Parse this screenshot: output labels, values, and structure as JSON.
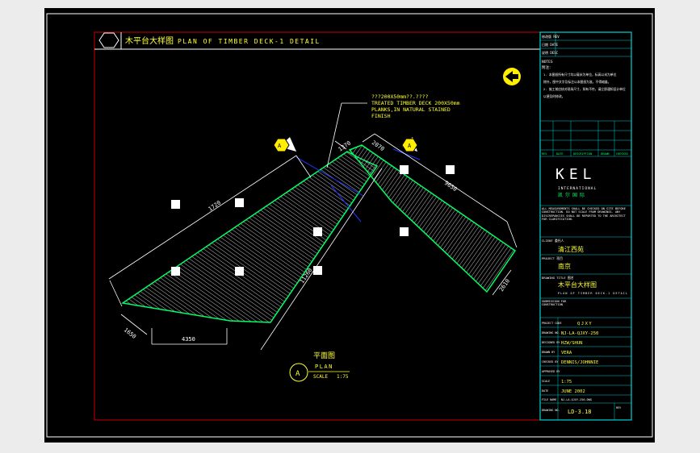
{
  "drawing": {
    "title_cn": "木平台大样图",
    "title_en": "PLAN OF TIMBER DECK-1 DETAIL",
    "note_line1": "???200X50mm??.????",
    "note_line2": "TREATED TIMBER DECK 200X50mm",
    "note_line3": "PLANKS,IN NATURAL STAINED",
    "note_line4": "FINISH",
    "dimensions": {
      "top_left": "1720",
      "top_short": "1370",
      "top_right_short": "2070",
      "right_long": "9650",
      "right_end": "2610",
      "center_long": "11260",
      "left_end": "1650",
      "bottom": "4350"
    },
    "section_marks": [
      "A",
      "A"
    ],
    "plan_label_cn": "平面图",
    "plan_label_en": "PLAN",
    "scale_label": "SCALE",
    "scale_value": "1:75",
    "plan_bubble": "A"
  },
  "title_block": {
    "rev_label": "修改版 REV",
    "date_label": "日期 DATE",
    "desc_label": "说明 DESC",
    "notes_label": "NOTES",
    "notes_sub": "附注：",
    "note_a": "1. 本图纸所有尺寸均以毫米为单位，标高以米为单位",
    "note_b": "   除外，图中文字及标注以本图纸为准，不得缩量。",
    "note_c": "2. 施工前应核对现场尺寸，如有不符，请立即通知设计单位",
    "note_d": "   以便及时修改。",
    "rev_cols": [
      "REV",
      "DATE",
      "DESCRIPTION",
      "DRAWN",
      "CHECKED"
    ],
    "company_logo": "KEL",
    "company_sub": "INTERNATIONAL",
    "company_cn": "凯尔国际",
    "disclaimer": "ALL MEASUREMENTS SHALL BE CHECKED ON SITE BEFORE CONSTRUCTION. DO NOT SCALE FROM DRAWINGS. ANY DISCREPANCIES SHALL BE REPORTED TO THE ARCHITECT FOR CLARIFICATION.",
    "client_label": "CLIENT 委托人",
    "client_value": "清江西苑",
    "project_label": "PROJECT 项目",
    "project_value": "南京",
    "drawing_label": "DRAWING TITLE 图名",
    "drawing_value": "木平台大样图",
    "drawing_value_en": "PLAN OF TIMBER DECK-1 DETAIL",
    "status_label": "SUBMISSION FOR CONSTRUCTION",
    "project_code_label": "PROJECT CODE",
    "project_code_value": "QJXY",
    "drawing_no_label": "DRAWING NO.",
    "drawing_no_value": "NJ-LA-QJXY-250",
    "designed_label": "DESIGNED BY",
    "designed_value": "HZW/SHUN",
    "drawn_label": "DRAWN BY",
    "drawn_value": "VERA",
    "checked_label": "CHECKED BY",
    "checked_value": "DENNIS/JOHNNIE",
    "approved_label": "APPROVED BY",
    "approved_value": "",
    "scale_label": "SCALE",
    "scale_value": "1:75",
    "date_label2": "DATE",
    "date_value": "JUNE 2002",
    "file_label": "FILE NAME",
    "file_value": "NJ-LA-QJXY-250.DWG",
    "sheet_label": "DRAWING NO.",
    "sheet_value": "LD-3.18",
    "rev_label2": "REV"
  },
  "colors": {
    "frame_red": "#cc0000",
    "title_cyan": "#00d0d0",
    "deck_green": "#00ff66",
    "text_yellow": "#ffff33",
    "dim_white": "#ffffff",
    "arrow_yellow": "#ffee00",
    "section_blue": "#2233ff"
  }
}
